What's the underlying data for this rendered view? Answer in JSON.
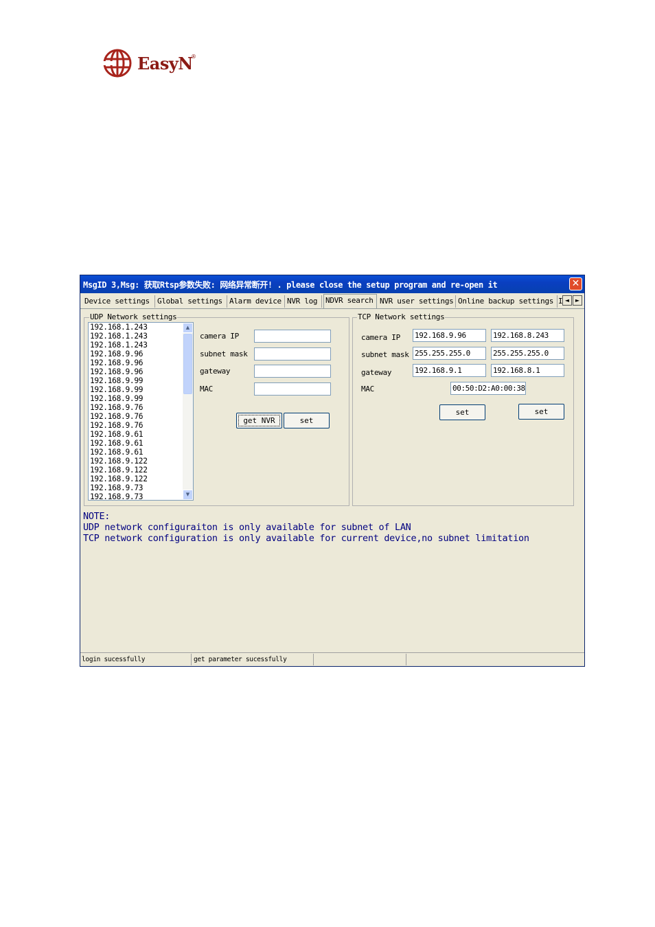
{
  "logo": {
    "text": "EasyN",
    "reg": "®"
  },
  "window": {
    "title": "MsgID 3,Msg: 获取Rtsp参数失败: 网络异常断开! . please close the setup program and re-open it",
    "close_label": "✕"
  },
  "tabs": [
    {
      "label": "Device settings"
    },
    {
      "label": "Global settings"
    },
    {
      "label": "Alarm device"
    },
    {
      "label": "NVR log"
    },
    {
      "label": "NDVR search",
      "active": true
    },
    {
      "label": "NVR user settings"
    },
    {
      "label": "Online backup settings"
    },
    {
      "label": "I"
    }
  ],
  "tab_scroll": {
    "left": "◄",
    "right": "►"
  },
  "udp": {
    "legend": "UDP Network settings",
    "list": [
      "192.168.1.243",
      "192.168.1.243",
      "192.168.1.243",
      "192.168.9.96",
      "192.168.9.96",
      "192.168.9.96",
      "192.168.9.99",
      "192.168.9.99",
      "192.168.9.99",
      "192.168.9.76",
      "192.168.9.76",
      "192.168.9.76",
      "192.168.9.61",
      "192.168.9.61",
      "192.168.9.61",
      "192.168.9.122",
      "192.168.9.122",
      "192.168.9.122",
      "192.168.9.73",
      "192.168.9.73"
    ],
    "scroll_up": "▲",
    "scroll_down": "▼",
    "labels": {
      "camera_ip": "camera IP",
      "subnet_mask": "subnet mask",
      "gateway": "gateway",
      "mac": "MAC"
    },
    "values": {
      "camera_ip": "",
      "subnet_mask": "",
      "gateway": "",
      "mac": ""
    },
    "get_button": "get NVR",
    "set_button": "set"
  },
  "tcp": {
    "legend": "TCP Network settings",
    "labels": {
      "camera_ip": "camera IP",
      "subnet_mask": "subnet mask",
      "gateway": "gateway",
      "mac": "MAC"
    },
    "col1": {
      "camera_ip": "192.168.9.96",
      "subnet_mask": "255.255.255.0",
      "gateway": "192.168.9.1"
    },
    "col2": {
      "camera_ip": "192.168.8.243",
      "subnet_mask": "255.255.255.0",
      "gateway": "192.168.8.1"
    },
    "mac": "00:50:D2:A0:00:38",
    "set_button_1": "set",
    "set_button_2": "set"
  },
  "note": {
    "title": "NOTE:",
    "line1": "UDP network configuraiton is only available for subnet of LAN",
    "line2": "TCP network configuration is only available for current device,no subnet limitation"
  },
  "status": {
    "cell1": "login sucessfully",
    "cell2": "get parameter sucessfully",
    "cell3": "",
    "cell4": ""
  }
}
